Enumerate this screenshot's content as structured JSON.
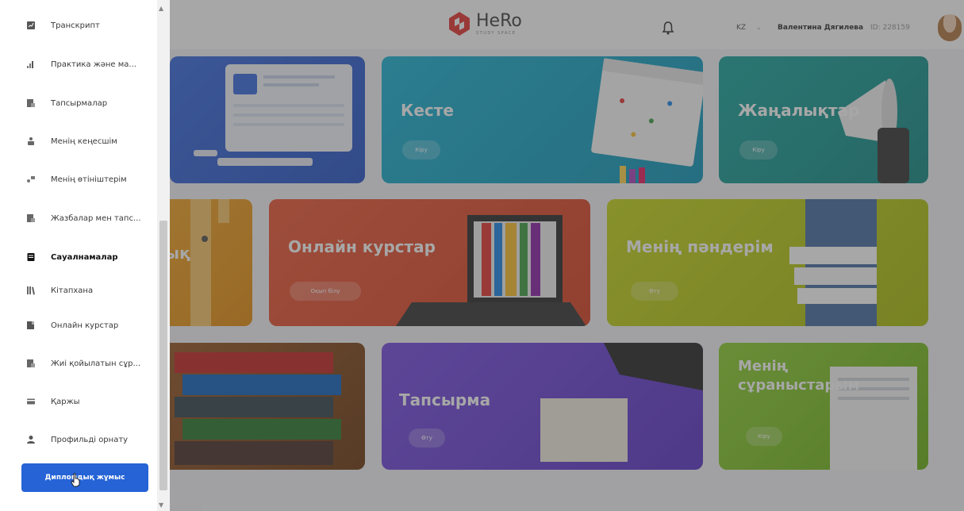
{
  "header": {
    "logo_name": "HeRo",
    "logo_sub": "STUDY SPACE",
    "lang": "KZ",
    "lang_caret": "⌄",
    "user_name": "Валентина Дягилева",
    "user_id": "ID: 228159"
  },
  "cards": [
    {
      "title": "",
      "button": ""
    },
    {
      "title": "Кесте",
      "button": "Кіру"
    },
    {
      "title": "Жаңалықтар",
      "button": "Кіру"
    },
    {
      "title": "ық",
      "button": ""
    },
    {
      "title": "Онлайн курстар",
      "button": "Оқып бiлу"
    },
    {
      "title": "Менің пәндерім",
      "button": "Өту"
    },
    {
      "title": "",
      "button": ""
    },
    {
      "title": "Тапсырма",
      "button": "Өту"
    },
    {
      "title": "Менің сұраныстарым",
      "button": "Кіру"
    }
  ],
  "sidebar": {
    "items": [
      {
        "label": "Транскрипт",
        "icon": "transcript-icon"
      },
      {
        "label": "Практика және ма...",
        "icon": "practice-icon"
      },
      {
        "label": "Тапсырмалар",
        "icon": "tasks-icon"
      },
      {
        "label": "Менің кеңесшім",
        "icon": "advisor-icon"
      },
      {
        "label": "Менің өтініштерім",
        "icon": "requests-icon"
      },
      {
        "label": "Жазбалар мен тапс...",
        "icon": "records-icon"
      },
      {
        "label": "Сауалнамалар",
        "icon": "survey-icon"
      },
      {
        "label": "Кітапхана",
        "icon": "library-icon"
      },
      {
        "label": "Онлайн курстар",
        "icon": "courses-icon"
      },
      {
        "label": "Жиі қойылатын сұр...",
        "icon": "faq-icon"
      },
      {
        "label": "Қаржы",
        "icon": "finance-icon"
      },
      {
        "label": "Профильді орнату",
        "icon": "profile-icon"
      }
    ],
    "active_index": 6,
    "diploma_button": "Дипломдық жұмыс"
  },
  "colors": {
    "accent": "#2563d6",
    "logo_red": "#e53935"
  }
}
